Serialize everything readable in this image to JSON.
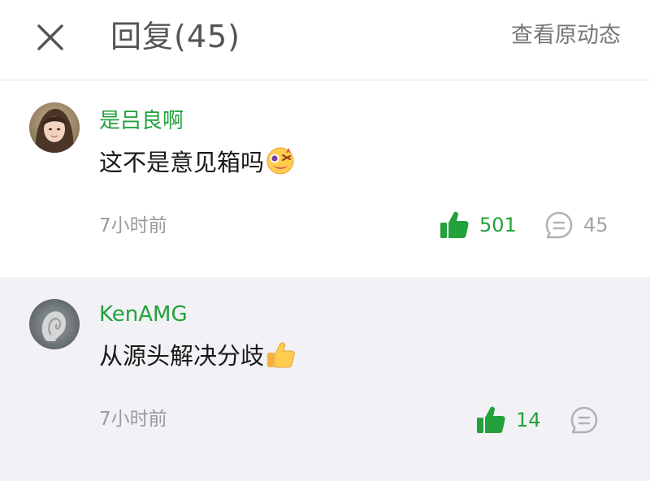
{
  "header": {
    "close_icon": "close-icon",
    "title": "回复(45)",
    "view_original": "查看原动态"
  },
  "comments": [
    {
      "username": "是吕良啊",
      "text": "这不是意见箱吗",
      "emoji": "dizzy-face-emoji",
      "time": "7小时前",
      "likes": "501",
      "replies": "45",
      "background": "#ffffff"
    },
    {
      "username": "KenAMG",
      "text": "从源头解决分歧",
      "emoji": "thumbs-up-emoji",
      "time": "7小时前",
      "likes": "14",
      "replies": "",
      "background": "#f2f1f6"
    }
  ],
  "colors": {
    "accent_green": "#23a13b",
    "muted_text": "#9b9b9b",
    "title_text": "#555555"
  }
}
